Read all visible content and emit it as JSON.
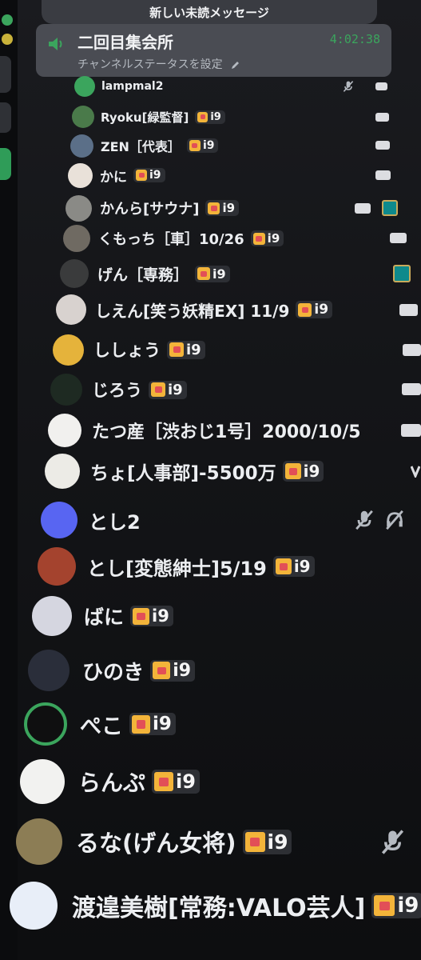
{
  "banner": {
    "text": "新しい未読メッセージ"
  },
  "voice_channel": {
    "name": "二回目集会所",
    "status_placeholder": "チャンネルステータスを設定",
    "timer": "4:02:38"
  },
  "badge_label": "i9",
  "members": [
    {
      "name": "lampmal2",
      "avatar_color": "#3ba55d",
      "badge": false,
      "icons": [
        "mic-muted-icon",
        "camera-icon"
      ]
    },
    {
      "name": "Ryoku[緑監督]",
      "avatar_color": "#4a7a4a",
      "badge": true,
      "icons": [
        "camera-icon"
      ]
    },
    {
      "name": "ZEN［代表］",
      "avatar_color": "#5b6f88",
      "badge": true,
      "icons": [
        "camera-icon"
      ]
    },
    {
      "name": "かに",
      "avatar_color": "#e9e1d9",
      "badge": true,
      "icons": [
        "camera-icon"
      ]
    },
    {
      "name": "かんら[サウナ]",
      "avatar_color": "#8a8a86",
      "badge": true,
      "icons": [
        "camera-icon",
        "league-icon"
      ]
    },
    {
      "name": "くもっち［車］10/26",
      "avatar_color": "#6f6a62",
      "badge": true,
      "icons": [
        "camera-icon"
      ]
    },
    {
      "name": "げん［専務］",
      "avatar_color": "#3a3b3c",
      "badge": true,
      "icons": [
        "league-icon"
      ]
    },
    {
      "name": "しえん[笑う妖精EX] 11/9",
      "avatar_color": "#d8d2cf",
      "badge": true,
      "icons": [
        "camera-icon"
      ]
    },
    {
      "name": "ししょう",
      "avatar_color": "#e5b33b",
      "badge": true,
      "icons": [
        "camera-icon"
      ]
    },
    {
      "name": "じろう",
      "avatar_color": "#1e2a22",
      "badge": true,
      "icons": [
        "camera-icon"
      ]
    },
    {
      "name": "たつ産［渋おじ1号］2000/10/5",
      "avatar_color": "#f1f0ee",
      "badge": false,
      "icons": [
        "camera-icon"
      ]
    },
    {
      "name": "ちょ[人事部]-5500万",
      "avatar_color": "#ecebe6",
      "badge": true,
      "icons": [
        "chevron-icon"
      ]
    },
    {
      "name": "とし2",
      "avatar_color": "#5865f2",
      "badge": false,
      "icons": [
        "mic-muted-icon",
        "deafened-icon"
      ]
    },
    {
      "name": "とし[変態紳士]5/19",
      "avatar_color": "#a4432e",
      "badge": true,
      "icons": []
    },
    {
      "name": "ばに",
      "avatar_color": "#d5d6e0",
      "badge": true,
      "icons": []
    },
    {
      "name": "ひのき",
      "avatar_color": "#2a2e3a",
      "badge": true,
      "icons": []
    },
    {
      "name": "ぺこ",
      "avatar_color": "#0f0f10",
      "badge": true,
      "icons": []
    },
    {
      "name": "らんぷ",
      "avatar_color": "#f2f2f0",
      "badge": true,
      "icons": []
    },
    {
      "name": "るな(げん女将)",
      "avatar_color": "#8c7d55",
      "badge": true,
      "icons": [
        "mic-muted-icon"
      ]
    },
    {
      "name": "渡遑美樹[常務:VALO芸人]",
      "avatar_color": "#e8eef8",
      "badge": true,
      "icons": []
    }
  ]
}
